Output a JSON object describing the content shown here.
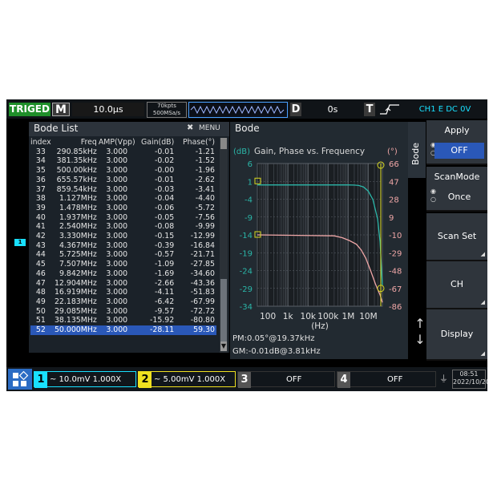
{
  "top_bar": {
    "trigger_status": "TRIGED",
    "mode_letter": "M",
    "timebase": "10.0µs",
    "memory_depth": "70kpts",
    "sample_rate": "500MSa/s",
    "delay_letter": "D",
    "delay_value": "0s",
    "trigger_letter": "T",
    "trigger_source": "CH1 E DC 0V"
  },
  "bode_list": {
    "title": "Bode List",
    "close_glyph": "✖",
    "menu_label": "MENU",
    "columns": [
      "index",
      "Freq",
      "AMP(Vpp)",
      "Gain(dB)",
      "Phase(°)"
    ],
    "rows": [
      [
        "33",
        "290.85kHz",
        "3.000",
        "-0.01",
        "-1.21"
      ],
      [
        "34",
        "381.35kHz",
        "3.000",
        "-0.02",
        "-1.52"
      ],
      [
        "35",
        "500.00kHz",
        "3.000",
        "-0.00",
        "-1.96"
      ],
      [
        "36",
        "655.57kHz",
        "3.000",
        "-0.01",
        "-2.62"
      ],
      [
        "37",
        "859.54kHz",
        "3.000",
        "-0.03",
        "-3.41"
      ],
      [
        "38",
        "1.127MHz",
        "3.000",
        "-0.04",
        "-4.40"
      ],
      [
        "39",
        "1.478MHz",
        "3.000",
        "-0.06",
        "-5.72"
      ],
      [
        "40",
        "1.937MHz",
        "3.000",
        "-0.05",
        "-7.56"
      ],
      [
        "41",
        "2.540MHz",
        "3.000",
        "-0.08",
        "-9.99"
      ],
      [
        "42",
        "3.330MHz",
        "3.000",
        "-0.15",
        "-12.99"
      ],
      [
        "43",
        "4.367MHz",
        "3.000",
        "-0.39",
        "-16.84"
      ],
      [
        "44",
        "5.725MHz",
        "3.000",
        "-0.57",
        "-21.71"
      ],
      [
        "45",
        "7.507MHz",
        "3.000",
        "-1.09",
        "-27.85"
      ],
      [
        "46",
        "9.842MHz",
        "3.000",
        "-1.69",
        "-34.60"
      ],
      [
        "47",
        "12.904MHz",
        "3.000",
        "-2.66",
        "-43.36"
      ],
      [
        "48",
        "16.919MHz",
        "3.000",
        "-4.11",
        "-51.83"
      ],
      [
        "49",
        "22.183MHz",
        "3.000",
        "-6.42",
        "-67.99"
      ],
      [
        "50",
        "29.085MHz",
        "3.000",
        "-9.57",
        "-72.72"
      ],
      [
        "51",
        "38.135MHz",
        "3.000",
        "-15.92",
        "-80.80"
      ],
      [
        "52",
        "50.000MHz",
        "3.000",
        "-28.11",
        "59.30"
      ]
    ],
    "selected_index": "52"
  },
  "bode_panel": {
    "title": "Bode",
    "tab_label": "Bode",
    "pm_readout": "PM:0.05°@19.37kHz",
    "gm_readout": "GM:-0.01dB@3.81kHz"
  },
  "chart_data": {
    "type": "line",
    "title": "Gain, Phase vs. Frequency",
    "xlabel": "(Hz)",
    "ylabel_left": "(dB)",
    "ylabel_right": "(°)",
    "x_scale": "log",
    "x_range": [
      30,
      50000000
    ],
    "x_ticks": [
      100,
      1000,
      10000,
      100000,
      1000000,
      10000000
    ],
    "x_tick_labels": [
      "100",
      "1k",
      "10k",
      "100k",
      "1M",
      "10M"
    ],
    "ylim_left": [
      -34,
      6
    ],
    "y_ticks_left": [
      6,
      1,
      -4,
      -9,
      -14,
      -19,
      -24,
      -29,
      -34
    ],
    "ylim_right": [
      -86,
      66
    ],
    "y_ticks_right": [
      66,
      47,
      28,
      9,
      -10,
      -29,
      -48,
      -67,
      -86
    ],
    "grid": true,
    "series": [
      {
        "name": "Gain",
        "axis": "left",
        "color": "#2bb6a8",
        "x": [
          30,
          1000000,
          2000000,
          3330000,
          5725000,
          9842000,
          16919000,
          29085000,
          38135000,
          50000000
        ],
        "y": [
          0,
          0,
          -0.05,
          -0.15,
          -0.57,
          -1.69,
          -4.11,
          -9.57,
          -15.92,
          -28.11
        ]
      },
      {
        "name": "Phase",
        "axis": "right",
        "color": "#f0a7a7",
        "x": [
          30,
          200000,
          500000,
          1127000,
          2540000,
          4367000,
          7507000,
          12904000,
          22183000,
          38135000,
          50000000
        ],
        "y": [
          -10,
          -11,
          -13,
          -16,
          -20,
          -26,
          -35,
          -48,
          -62,
          -74,
          -82
        ]
      }
    ],
    "cursor_color": "#d8d820"
  },
  "right_menu": {
    "apply_label": "Apply",
    "apply_value": "OFF",
    "scanmode_label": "ScanMode",
    "scanmode_value": "Once",
    "scanset_label": "Scan Set",
    "ch_label": "CH",
    "display_label": "Display"
  },
  "bottom_bar": {
    "ch1_num": "1",
    "ch1_text": "~ 10.0mV 1.000X",
    "ch2_num": "2",
    "ch2_text": "~ 5.00mV 1.000X",
    "ch3_num": "3",
    "ch3_text": "OFF",
    "ch4_num": "4",
    "ch4_text": "OFF",
    "time": "08:51",
    "date": "2022/10/20",
    "ch1_color": "#19e0ff",
    "ch2_color": "#f0e020"
  },
  "ch1_marker": "1"
}
